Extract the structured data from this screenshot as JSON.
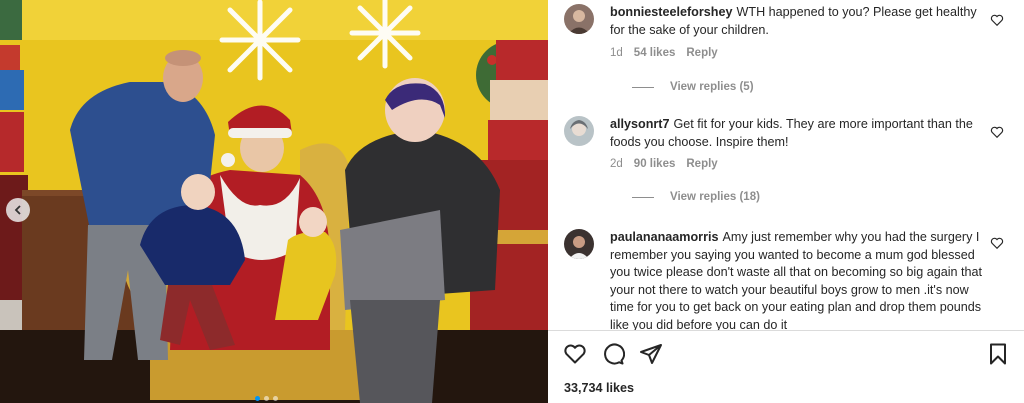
{
  "comments": [
    {
      "username": "bonniesteeleforshey",
      "text": "WTH happened to you? Please get healthy for the sake of your children.",
      "age": "1d",
      "likes": "54 likes",
      "reply_label": "Reply",
      "view_replies": "View replies (5)",
      "avatar_color": "#6b5a52"
    },
    {
      "username": "allysonrt7",
      "text": "Get fit for your kids. They are more important than the foods you choose. Inspire them!",
      "age": "2d",
      "likes": "90 likes",
      "reply_label": "Reply",
      "view_replies": "View replies (18)",
      "avatar_color": "#a9b3b8"
    },
    {
      "username": "paulananaamorris",
      "text": "Amy just remember why you had the surgery I remember you saying you wanted to become a mum god blessed you twice please don't waste all that on becoming so big again that your not there to watch your beautiful boys grow to men .it's now time for you to get back on your eating plan and drop them pounds like you did before you can do it",
      "avatar_color": "#3b3230"
    }
  ],
  "post": {
    "like_count": "33,734 likes",
    "slide_count": 3,
    "active_slide": 0
  },
  "icons": {
    "like": "heart-icon",
    "comment": "comment-bubble-icon",
    "share": "paper-plane-icon",
    "save": "bookmark-icon",
    "comment_like": "small-heart-icon",
    "prev": "chevron-left-icon"
  },
  "colors": {
    "text": "#262626",
    "secondary": "#8e8e8e",
    "divider": "#dbdbdb",
    "accent": "#0095f6"
  }
}
